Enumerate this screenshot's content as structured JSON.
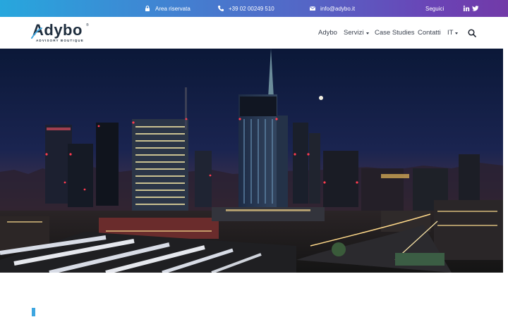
{
  "topbar": {
    "reserved_area": "Area riservata",
    "phone": "+39 02 00249 510",
    "email": "info@adybo.it",
    "follow": "Seguici",
    "social": [
      "linkedin-icon",
      "twitter-icon"
    ]
  },
  "logo": {
    "word": "Adybo",
    "tagline": "ADVISORY BOUTIQUE",
    "reg": "®"
  },
  "nav": {
    "items": [
      {
        "label": "Adybo"
      },
      {
        "label": "Servizi"
      },
      {
        "label": "Case Studies"
      },
      {
        "label": "Contatti"
      },
      {
        "label": "IT"
      }
    ]
  },
  "hero": {
    "image": "night-city-skyline"
  },
  "colors": {
    "gradient_start": "#27a7dd",
    "gradient_end": "#723aa8",
    "accent": "#3ea6e0",
    "text_dark": "#3c4350"
  }
}
